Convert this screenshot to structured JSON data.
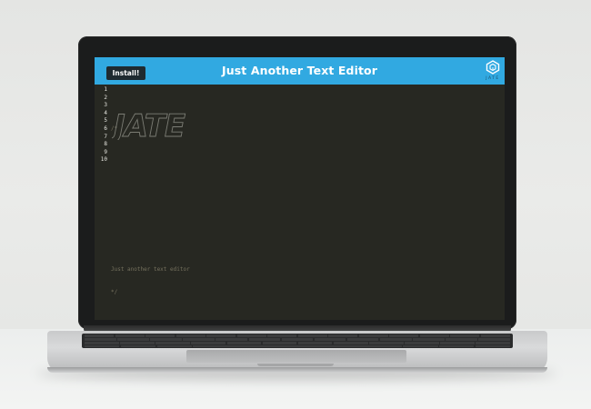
{
  "app": {
    "title": "Just Another Text Editor",
    "install_label": "Install!",
    "logo_text": "JATE",
    "header_color": "#31a9e1",
    "editor_background": "#272822"
  },
  "editor": {
    "line_numbers": [
      "1",
      "2",
      "3",
      "4",
      "5",
      "6",
      "7",
      "8",
      "9",
      "10"
    ],
    "lines": [
      "",
      "/*",
      "",
      "",
      "",
      "",
      "",
      "Just another text editor",
      "*/",
      ""
    ],
    "ascii_art_text": "JATE"
  },
  "icons": {
    "logo": "jate-cube-logo-icon"
  }
}
